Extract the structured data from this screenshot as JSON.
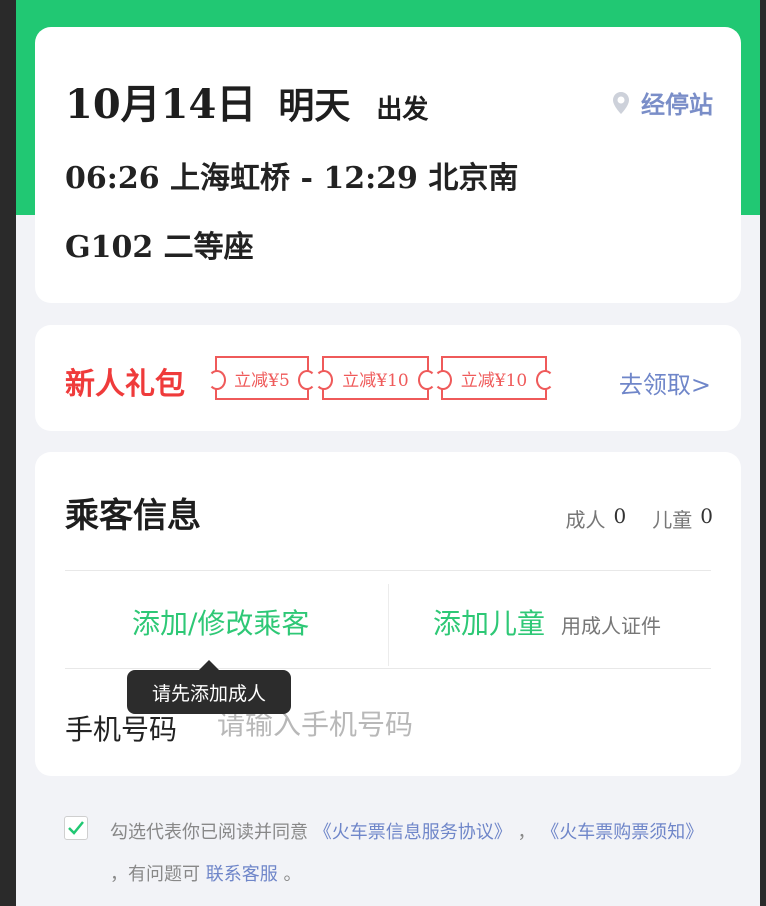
{
  "trip": {
    "date": "10月14日",
    "day": "明天",
    "depart_label": "出发",
    "stops_label": "经停站",
    "route": "06:26 上海虹桥 - 12:29 北京南",
    "train": "G102 二等座"
  },
  "promo": {
    "title": "新人礼包",
    "coupons": [
      "立减¥5",
      "立减¥10",
      "立减¥10"
    ],
    "claim": "去领取>"
  },
  "passengers": {
    "title": "乘客信息",
    "adult_label": "成人",
    "adult_count": "0",
    "child_label": "儿童",
    "child_count": "0",
    "add_passenger": "添加/修改乘客",
    "add_child": "添加儿童",
    "child_hint": "用成人证件",
    "phone_label": "手机号码",
    "phone_placeholder": "请输入手机号码",
    "tooltip": "请先添加成人"
  },
  "agreement": {
    "checked": true,
    "prefix": "勾选代表你已阅读并同意",
    "link1": "《火车票信息服务协议》",
    "sep": "，",
    "link2": "《火车票购票须知》",
    "middle": "，有问题可",
    "link3": "联系客服",
    "suffix": "。"
  },
  "colors": {
    "brand_green": "#21c873",
    "promo_red": "#ef3b3b",
    "link_blue": "#6f86c9"
  }
}
